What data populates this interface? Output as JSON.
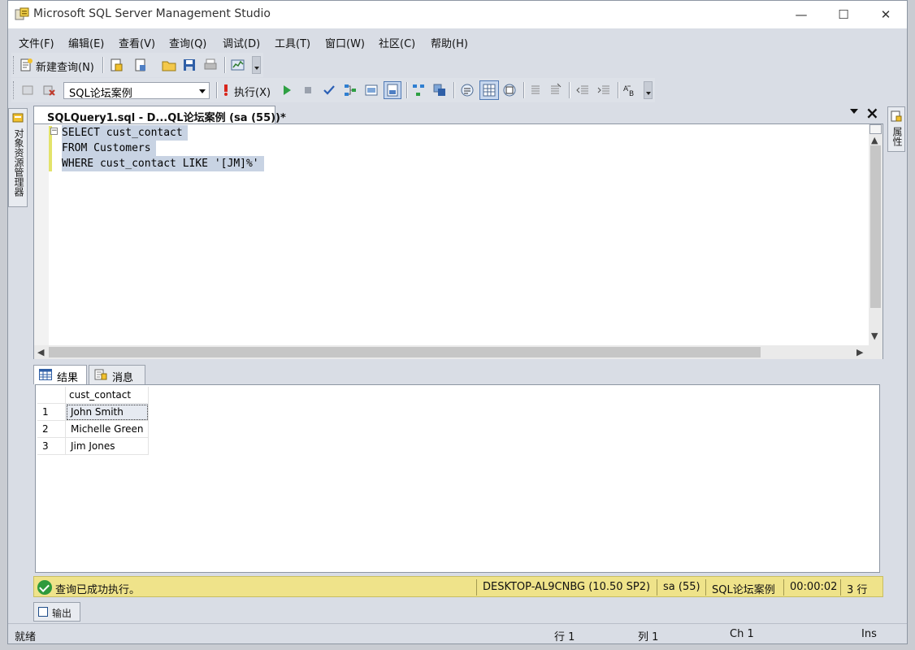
{
  "window": {
    "title": "Microsoft SQL Server Management Studio",
    "controls": {
      "minimize": "—",
      "maximize": "☐",
      "close": "✕"
    }
  },
  "menu": [
    "文件(F)",
    "编辑(E)",
    "查看(V)",
    "查询(Q)",
    "调试(D)",
    "工具(T)",
    "窗口(W)",
    "社区(C)",
    "帮助(H)"
  ],
  "toolbar1": {
    "new_query": "新建查询(N)"
  },
  "toolbar2": {
    "database": "SQL论坛案例",
    "execute": "执行(X)"
  },
  "side_panels": {
    "object_explorer": "对象资源管理器",
    "properties": "属性"
  },
  "document_tab": {
    "title": "SQLQuery1.sql - D...QL论坛案例 (sa (55))*"
  },
  "editor": {
    "lines": [
      "SELECT cust_contact",
      "FROM Customers",
      "WHERE cust_contact LIKE '[JM]%'"
    ]
  },
  "results": {
    "tabs": [
      "结果",
      "消息"
    ],
    "columns": [
      "cust_contact"
    ],
    "rows": [
      {
        "num": "1",
        "cust_contact": "John Smith"
      },
      {
        "num": "2",
        "cust_contact": "Michelle Green"
      },
      {
        "num": "3",
        "cust_contact": "Jim Jones"
      }
    ]
  },
  "query_status": {
    "message": "查询已成功执行。",
    "server": "DESKTOP-AL9CNBG (10.50 SP2)",
    "user": "sa (55)",
    "database": "SQL论坛案例",
    "elapsed": "00:00:02",
    "row_count": "3 行"
  },
  "output_tab": "输出",
  "statusbar": {
    "state": "就绪",
    "line": "行 1",
    "column": "列 1",
    "char": "Ch 1",
    "mode": "Ins"
  },
  "colors": {
    "status_bar_bg": "#efe38a",
    "selection": "#c8d3e3",
    "ok_green": "#2e9a3c"
  }
}
